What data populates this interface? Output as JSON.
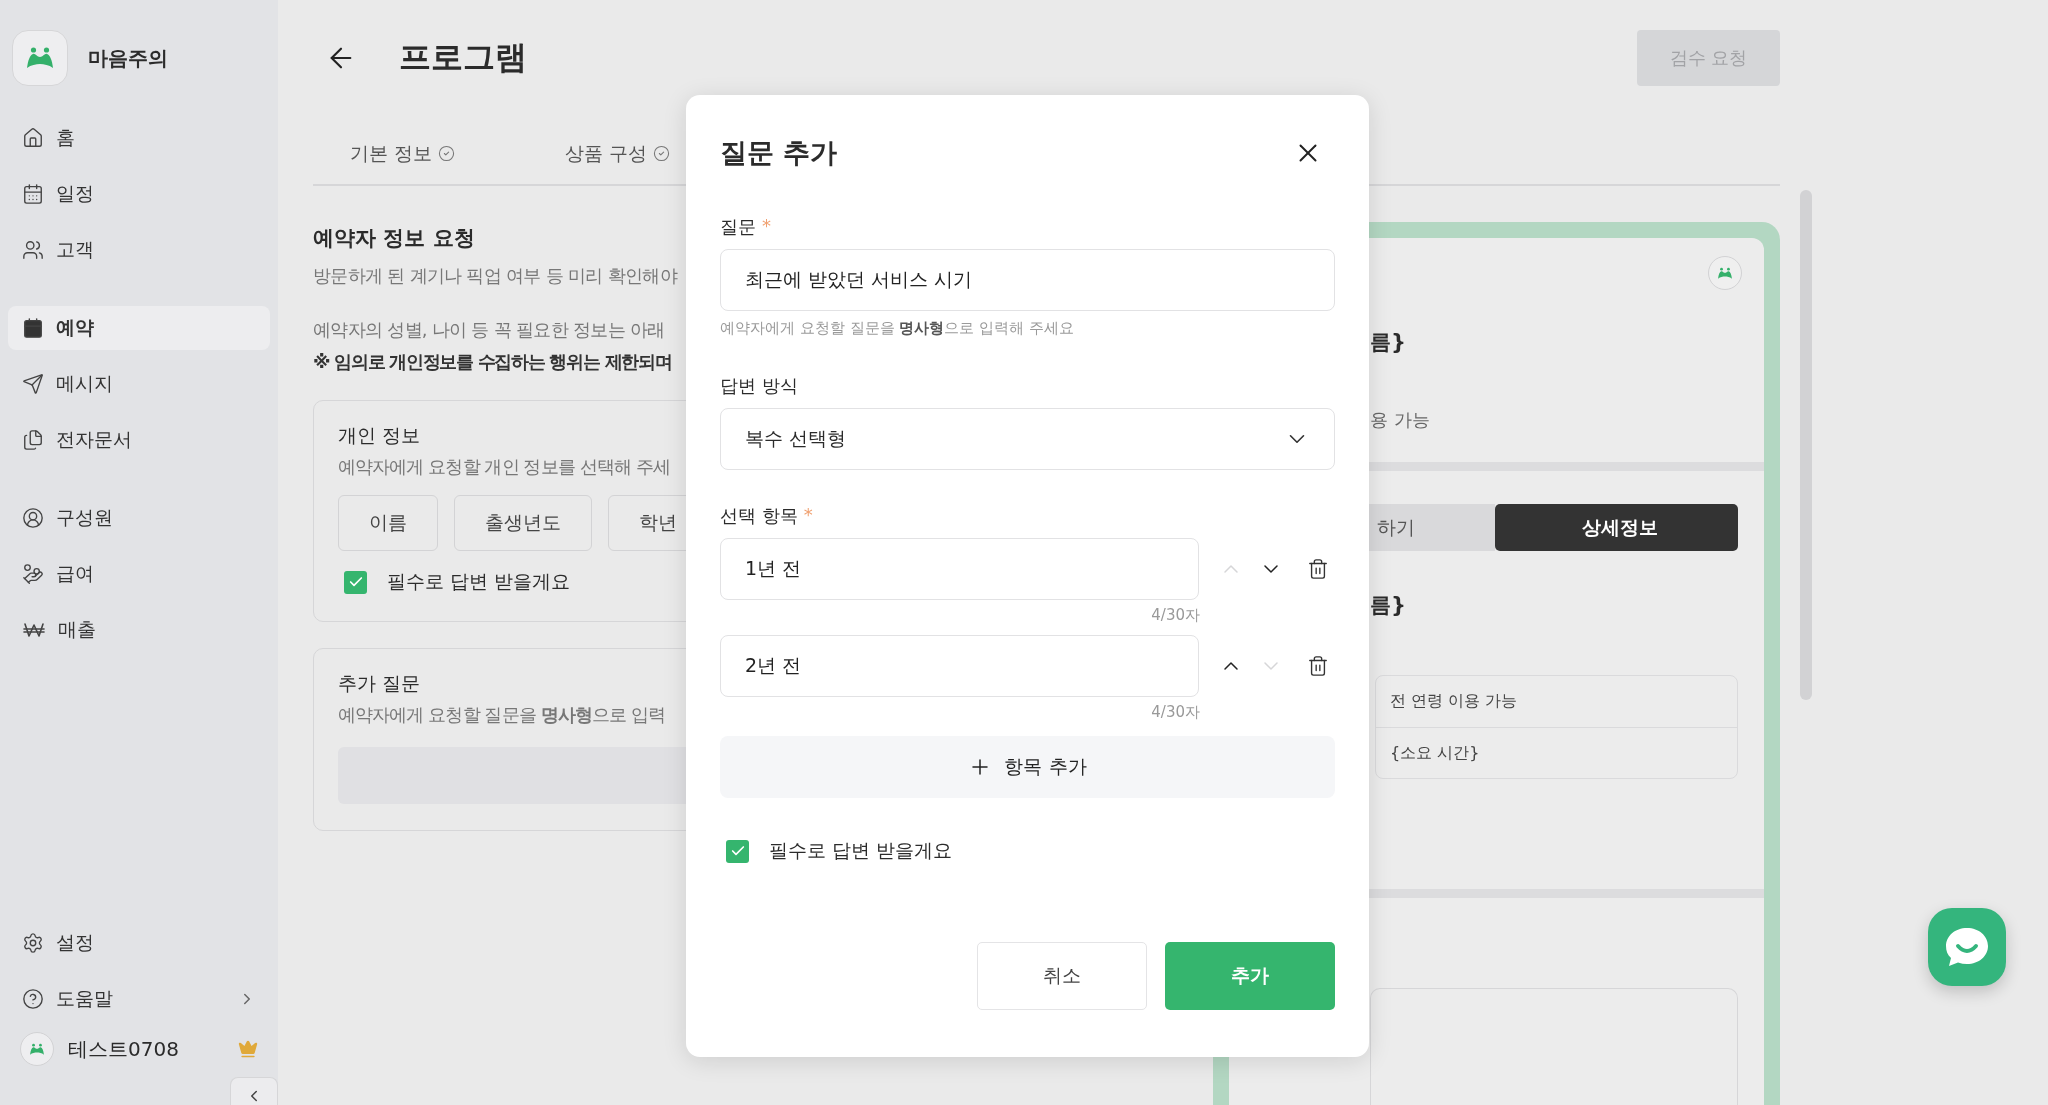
{
  "sidebar": {
    "brand": "마음주의",
    "nav_groups": [
      {
        "items": [
          {
            "label": "홈",
            "selected": false
          },
          {
            "label": "일정",
            "selected": false
          },
          {
            "label": "고객",
            "selected": false
          }
        ]
      },
      {
        "items": [
          {
            "label": "예약",
            "selected": true
          },
          {
            "label": "메시지",
            "selected": false
          },
          {
            "label": "전자문서",
            "selected": false
          }
        ]
      },
      {
        "items": [
          {
            "label": "구성원",
            "selected": false
          },
          {
            "label": "급여",
            "selected": false
          },
          {
            "label": "매출",
            "selected": false
          }
        ]
      }
    ],
    "footer_items": [
      {
        "label": "설정",
        "has_submenu": false
      },
      {
        "label": "도움말",
        "has_submenu": true
      }
    ],
    "user": {
      "name": "테스트0708",
      "premium": true
    }
  },
  "page": {
    "title": "프로그램",
    "review_button": {
      "label": "검수 요청",
      "disabled": true
    },
    "tabs": [
      {
        "label": "기본 정보",
        "completed": true,
        "selected": false
      },
      {
        "label": "상품 구성",
        "completed": true,
        "selected": false
      }
    ],
    "section": {
      "title": "예약자 정보 요청",
      "description": "방문하게 된 계기나 픽업 여부 등 미리 확인해야",
      "notes": [
        {
          "kind": "plain",
          "text": "예약자의 성별, 나이 등 꼭 필요한 정보는 아래"
        },
        {
          "kind": "warning",
          "text": "※ 임의로 개인정보를 수집하는 행위는 제한되며"
        }
      ]
    },
    "personal_info": {
      "title": "개인 정보",
      "description": "예약자에게 요청할 개인 정보를 선택해 주세",
      "chips": [
        "이름",
        "출생년도",
        "학년"
      ],
      "required": {
        "label": "필수로 답변 받을게요",
        "checked": true
      }
    },
    "extra_questions": {
      "title": "추가 질문",
      "description": "예약자에게 요청할 질문을 **명사형**으로 입력"
    },
    "preview": {
      "heading_1": "름}",
      "note": "용 가능",
      "segments": [
        {
          "label": "하기",
          "selected": false
        },
        {
          "label": "상세정보",
          "selected": true
        }
      ],
      "heading_2": "름}",
      "info_rows": [
        "전 연령 이용 가능",
        "{소요 시간}"
      ]
    }
  },
  "modal": {
    "title": "질문 추가",
    "question": {
      "label": "질문",
      "required_mark": "*",
      "value": "최근에 받았던 서비스 시기",
      "helper": "예약자에게 요청할 질문을 **명사형**으로 입력해 주세요"
    },
    "answer_type": {
      "label": "답변 방식",
      "value": "복수 선택형"
    },
    "options": {
      "label": "선택 항목",
      "required_mark": "*",
      "add_label": "항목 추가",
      "items": [
        {
          "value": "1년 전",
          "counter": "4/30자",
          "can_move_up": false,
          "can_move_down": true
        },
        {
          "value": "2년 전",
          "counter": "4/30자",
          "can_move_up": true,
          "can_move_down": false
        }
      ]
    },
    "required": {
      "label": "필수로 답변 받을게요",
      "checked": true
    },
    "buttons": [
      {
        "label": "취소",
        "kind": "secondary"
      },
      {
        "label": "추가",
        "kind": "primary"
      }
    ]
  }
}
